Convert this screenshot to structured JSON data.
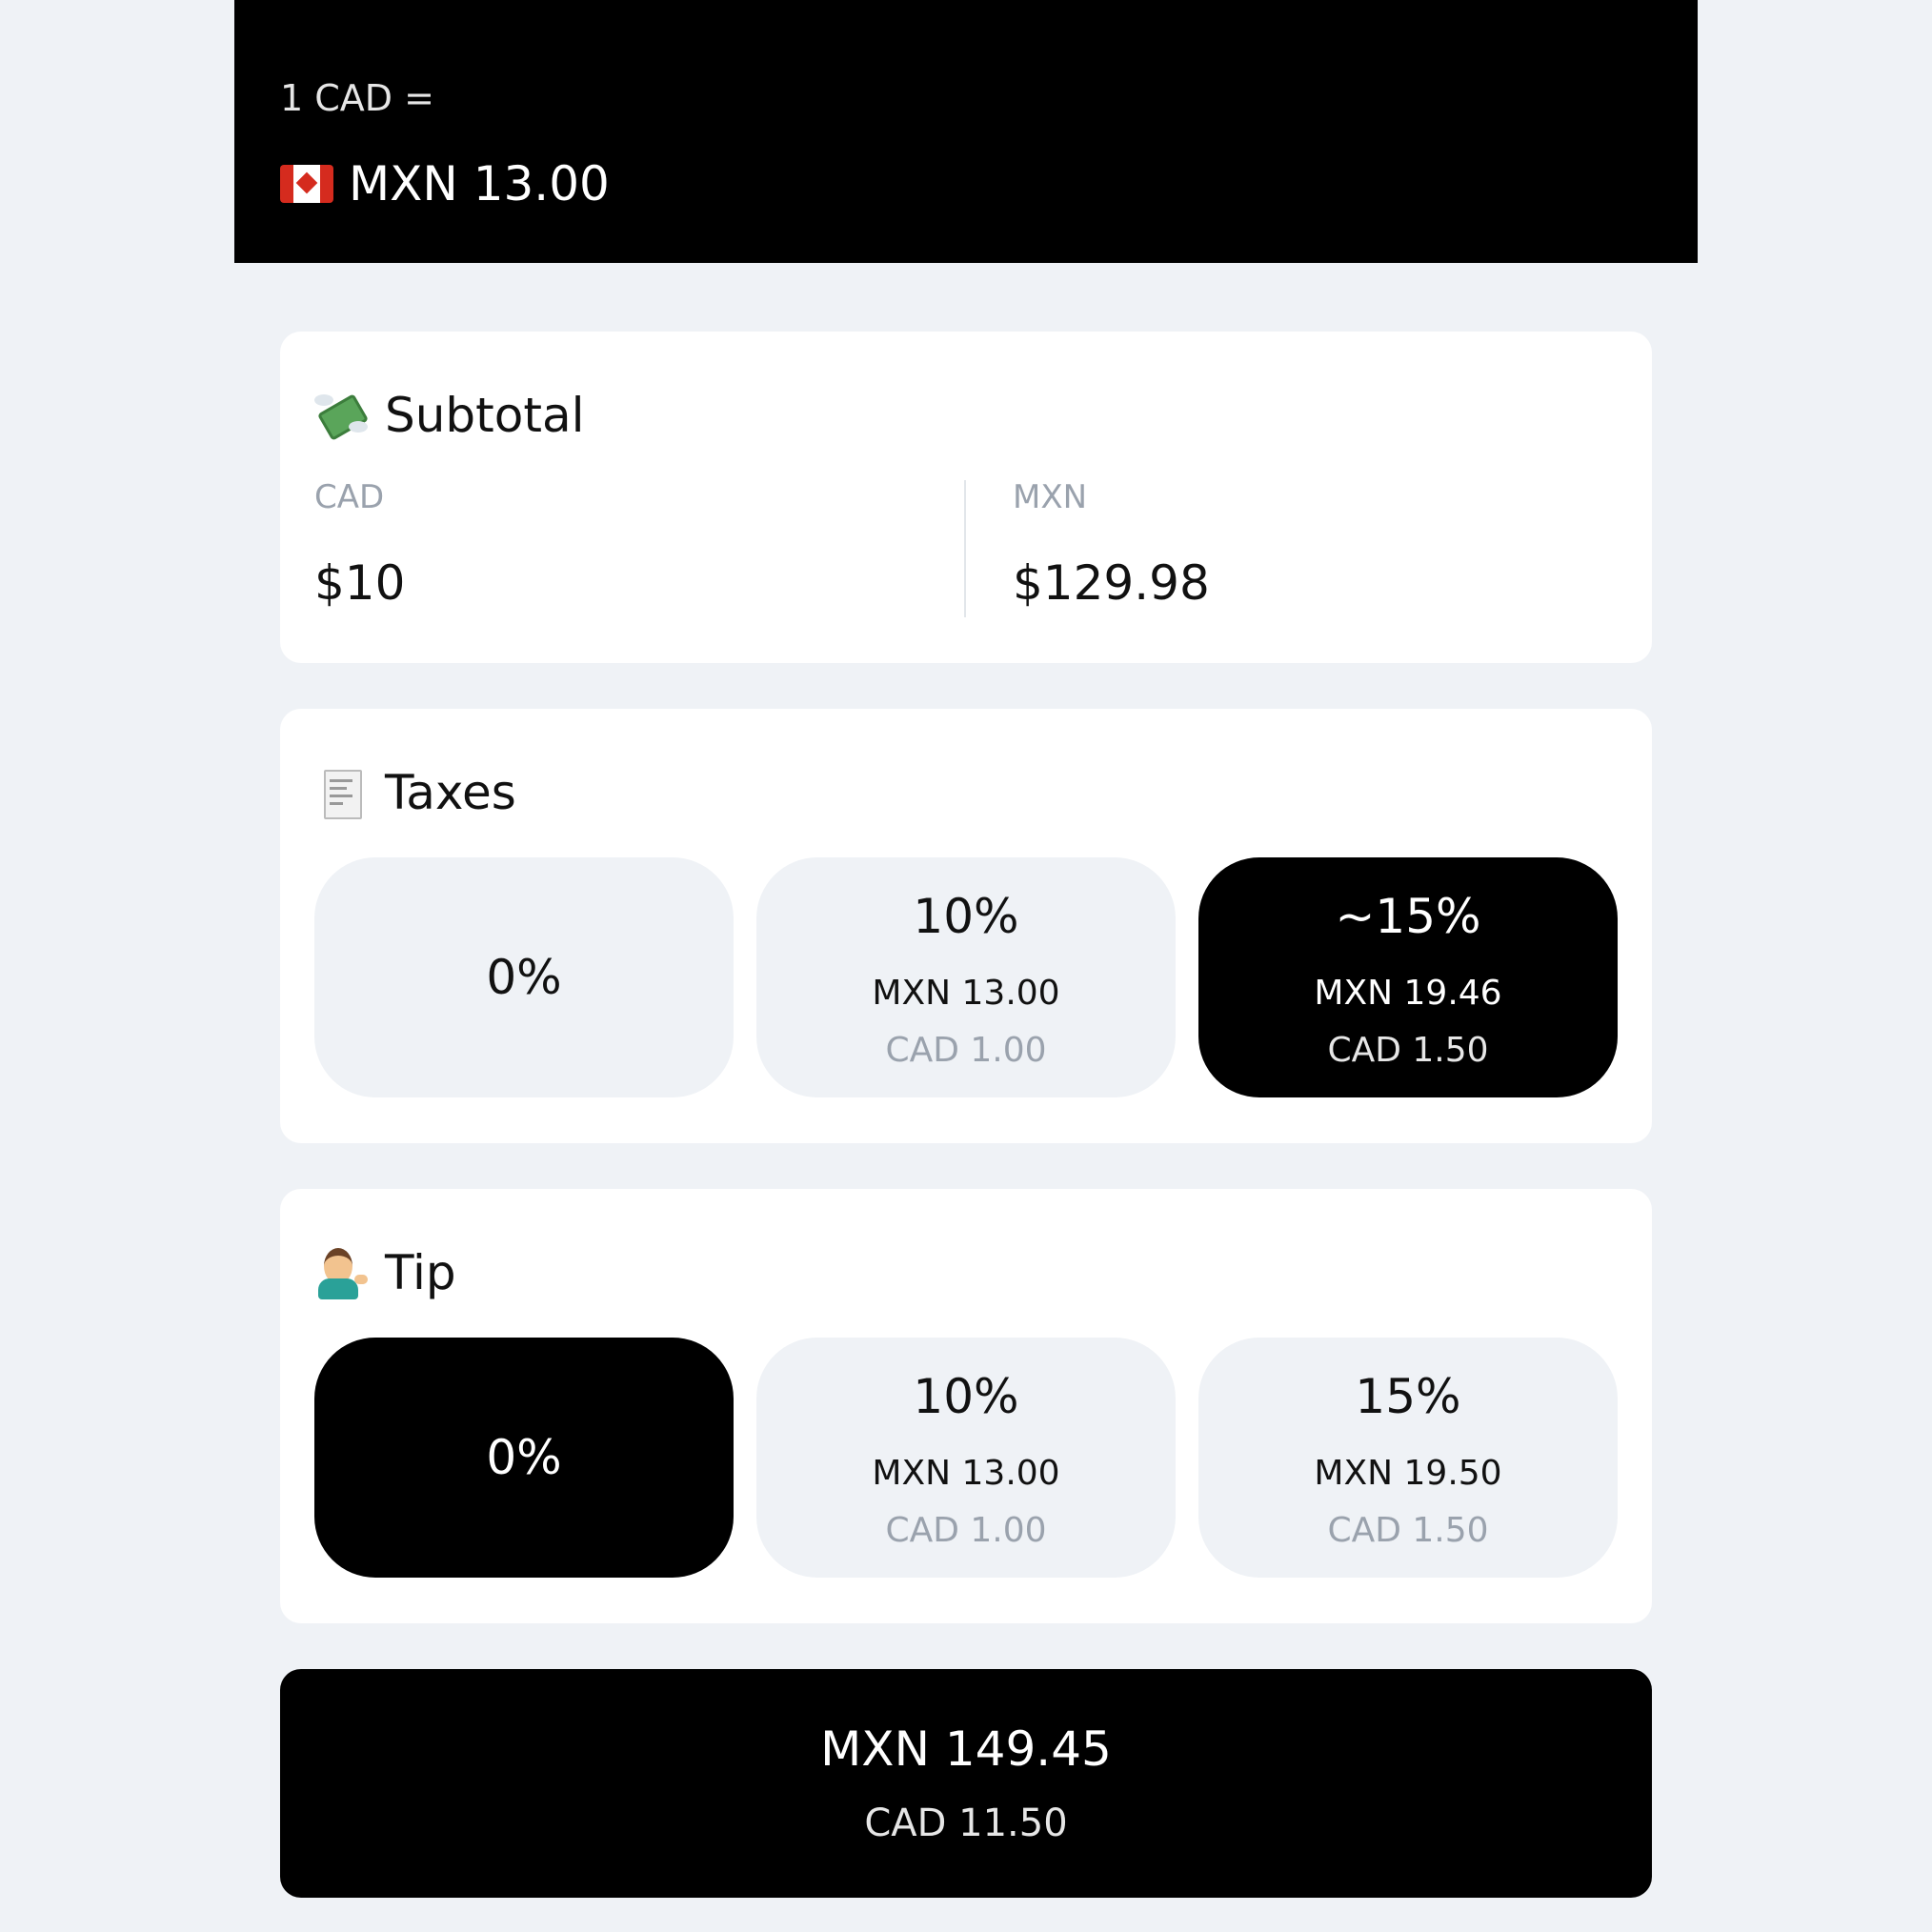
{
  "header": {
    "rate_label": "1 CAD =",
    "rate_value": "MXN 13.00",
    "flag_icon": "canada-flag-icon"
  },
  "subtotal": {
    "title": "Subtotal",
    "icon": "money-with-wings-icon",
    "left_label": "CAD",
    "left_value": "$10",
    "right_label": "MXN",
    "right_value": "$129.98"
  },
  "taxes": {
    "title": "Taxes",
    "icon": "receipt-icon",
    "options": [
      {
        "pct": "0%",
        "selected": false
      },
      {
        "pct": "10%",
        "mxn": "MXN 13.00",
        "cad": "CAD 1.00",
        "selected": false
      },
      {
        "pct": "~15%",
        "mxn": "MXN 19.46",
        "cad": "CAD 1.50",
        "selected": true
      }
    ]
  },
  "tip": {
    "title": "Tip",
    "icon": "person-tipping-hand-icon",
    "options": [
      {
        "pct": "0%",
        "selected": true
      },
      {
        "pct": "10%",
        "mxn": "MXN 13.00",
        "cad": "CAD 1.00",
        "selected": false
      },
      {
        "pct": "15%",
        "mxn": "MXN 19.50",
        "cad": "CAD 1.50",
        "selected": false
      }
    ]
  },
  "total": {
    "mxn": "MXN 149.45",
    "cad": "CAD 11.50"
  }
}
